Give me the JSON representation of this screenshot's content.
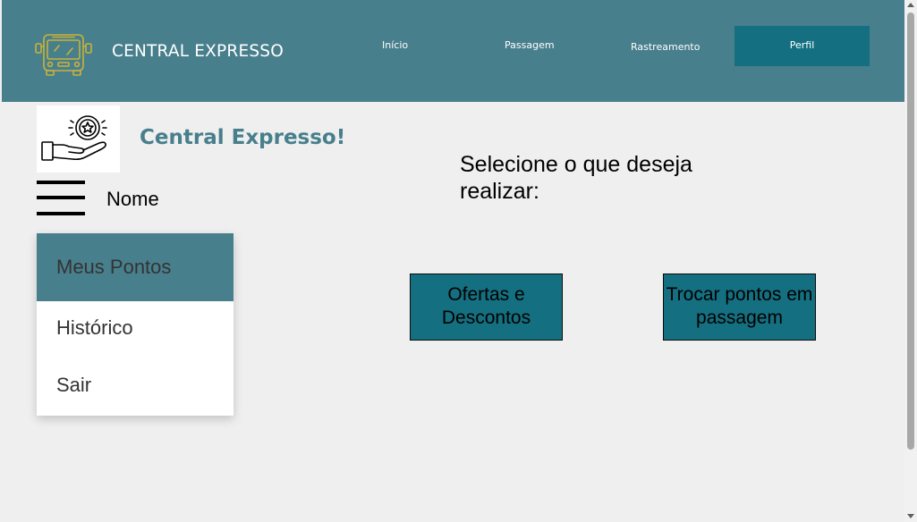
{
  "header": {
    "brand": "CENTRAL EXPRESSO",
    "logo_icon": "bus-icon",
    "nav": {
      "inicio": "Início",
      "passagem": "Passagem",
      "rastreamento": "Rastreamento",
      "perfil": "Perfil"
    }
  },
  "profile": {
    "logo_icon": "coin-in-hand-icon",
    "welcome": "Central Expresso!",
    "menu_icon": "hamburger-icon",
    "user_name": "Nome"
  },
  "sidebar": {
    "items": [
      {
        "label": "Meus Pontos",
        "active": true
      },
      {
        "label": "Histórico",
        "active": false
      },
      {
        "label": "Sair",
        "active": false
      }
    ]
  },
  "main": {
    "prompt": "Selecione o que deseja realizar:",
    "actions": {
      "ofertas": "Ofertas e Descontos",
      "trocar": "Trocar pontos em passagem"
    }
  },
  "colors": {
    "header_bg": "#487f8c",
    "accent": "#146f80",
    "logo_yellow": "#c9b23a",
    "page_bg": "#efefef"
  }
}
